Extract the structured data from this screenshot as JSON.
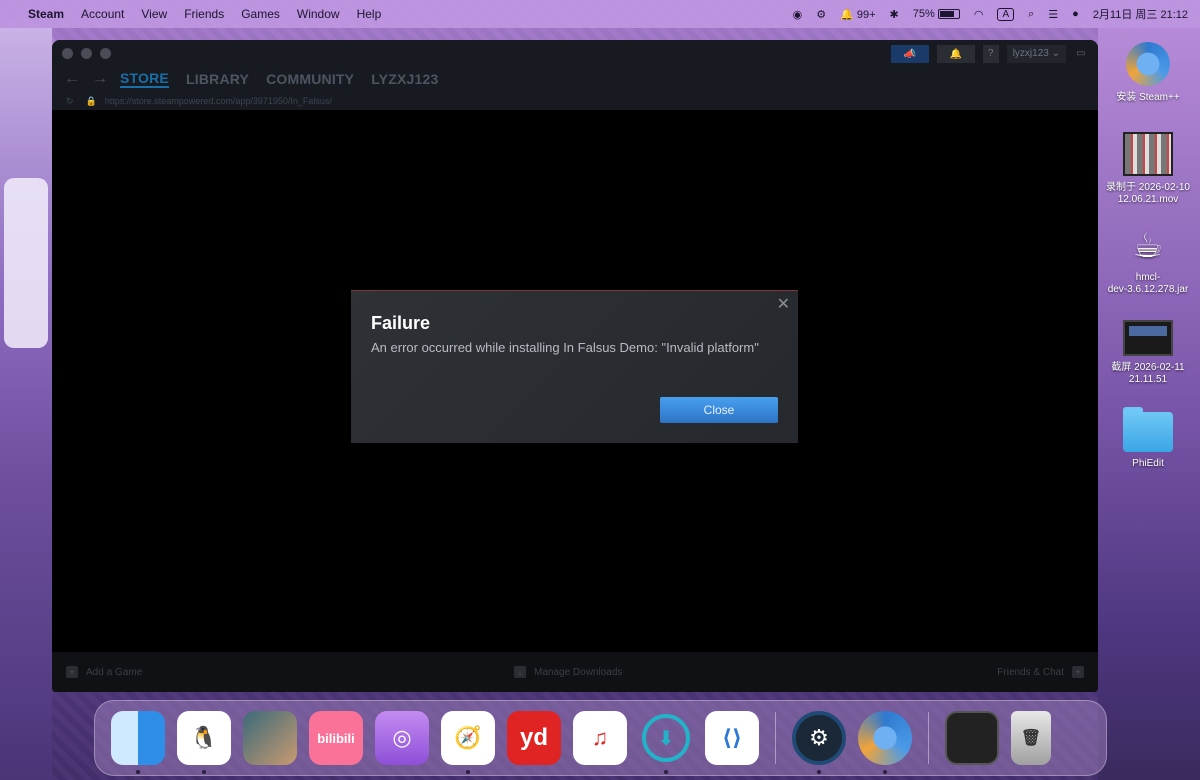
{
  "menubar": {
    "app_name": "Steam",
    "items": [
      "Account",
      "View",
      "Friends",
      "Games",
      "Window",
      "Help"
    ],
    "notification_count": "99+",
    "battery": "75%",
    "input_method": "A",
    "datetime": "2月11日 周三  21:12"
  },
  "steam": {
    "tabs": [
      "STORE",
      "LIBRARY",
      "COMMUNITY",
      "LYZXJ123"
    ],
    "active_tab": "STORE",
    "username": "lyzxj123",
    "url": "https://store.steampowered.com/app/3971950/In_Falsus/",
    "bottom": {
      "add_game": "Add a Game",
      "manage_downloads": "Manage Downloads",
      "friends_chat": "Friends & Chat"
    }
  },
  "dialog": {
    "title": "Failure",
    "message": "An error occurred while installing In Falsus Demo: \"Invalid platform\"",
    "button": "Close",
    "close_symbol": "✕"
  },
  "desktop_icons": [
    {
      "label_line1": "安装 Steam++",
      "label_line2": "",
      "icon": "steampp-icon"
    },
    {
      "label_line1": "录制于 2026-02-10",
      "label_line2": "12.06.21.mov",
      "icon": "video-file-icon"
    },
    {
      "label_line1": "hmcl-",
      "label_line2": "dev-3.6.12.278.jar",
      "icon": "java-coffee-icon"
    },
    {
      "label_line1": "截屏 2026-02-11",
      "label_line2": "21.11.51",
      "icon": "screenshot-file-icon"
    },
    {
      "label_line1": "PhiEdit",
      "label_line2": "",
      "icon": "folder-icon"
    }
  ],
  "dock": {
    "bilibili_text": "bilibili",
    "yd_text": "yd"
  },
  "colors": {
    "steam_accent": "#1a6fa8",
    "dialog_button": "#3a8ae0",
    "dialog_bg": "#2a2d32"
  }
}
